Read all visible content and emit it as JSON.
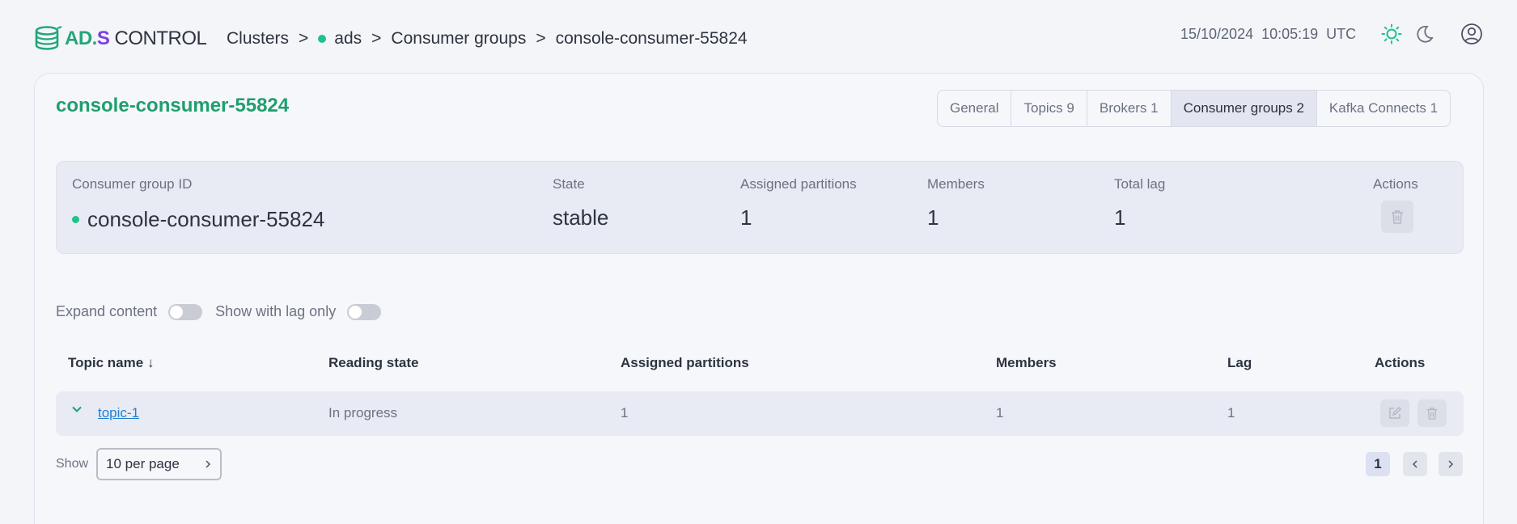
{
  "header": {
    "logo": {
      "ad": "AD",
      "dot": ".",
      "s": "S",
      "control": " CONTROL"
    },
    "breadcrumb": {
      "clusters": "Clusters",
      "cluster": "ads",
      "section": "Consumer groups",
      "current": "console-consumer-55824",
      "separator": ">"
    },
    "date": "15/10/2024",
    "time": "10:05:19",
    "timezone": "UTC"
  },
  "page": {
    "title": "console-consumer-55824",
    "tabs": [
      {
        "label": "General",
        "active": false
      },
      {
        "label": "Topics 9",
        "active": false
      },
      {
        "label": "Brokers 1",
        "active": false
      },
      {
        "label": "Consumer groups 2",
        "active": true
      },
      {
        "label": "Kafka Connects 1",
        "active": false
      }
    ]
  },
  "summary": {
    "group_id_label": "Consumer group ID",
    "group_id_value": "console-consumer-55824",
    "state_label": "State",
    "state_value": "stable",
    "partitions_label": "Assigned partitions",
    "partitions_value": "1",
    "members_label": "Members",
    "members_value": "1",
    "lag_label": "Total lag",
    "lag_value": "1",
    "actions_label": "Actions"
  },
  "filters": {
    "expand_label": "Expand content",
    "lag_only_label": "Show with lag only"
  },
  "table": {
    "columns": {
      "topic": "Topic name",
      "sort_icon": "↓",
      "reading_state": "Reading state",
      "partitions": "Assigned partitions",
      "members": "Members",
      "lag": "Lag",
      "actions": "Actions"
    },
    "rows": [
      {
        "topic": "topic-1",
        "reading_state": "In progress",
        "partitions": "1",
        "members": "1",
        "lag": "1"
      }
    ]
  },
  "pagination": {
    "show_label": "Show",
    "per_page": "10 per page",
    "current_page": "1"
  },
  "colors": {
    "accent_green": "#1f9e6f",
    "status_dot": "#1ec28b",
    "logo_purple": "#7b3fe4",
    "link": "#1f7fd1"
  },
  "icons": [
    "logo-icon",
    "sun-icon",
    "moon-icon",
    "user-icon",
    "trash-icon",
    "chevron-down-icon",
    "edit-icon",
    "chevron-right-icon",
    "chevron-left-icon"
  ]
}
